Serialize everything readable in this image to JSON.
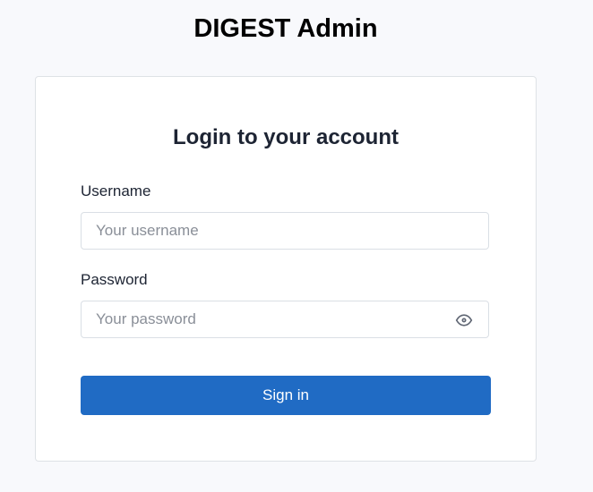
{
  "brand": "DIGEST Admin",
  "card": {
    "title": "Login to your account",
    "username": {
      "label": "Username",
      "placeholder": "Your username",
      "value": ""
    },
    "password": {
      "label": "Password",
      "placeholder": "Your password",
      "value": "",
      "toggle_icon": "eye-icon"
    },
    "submit_label": "Sign in"
  },
  "colors": {
    "primary": "#206bc4",
    "background": "#f8f9fc"
  }
}
